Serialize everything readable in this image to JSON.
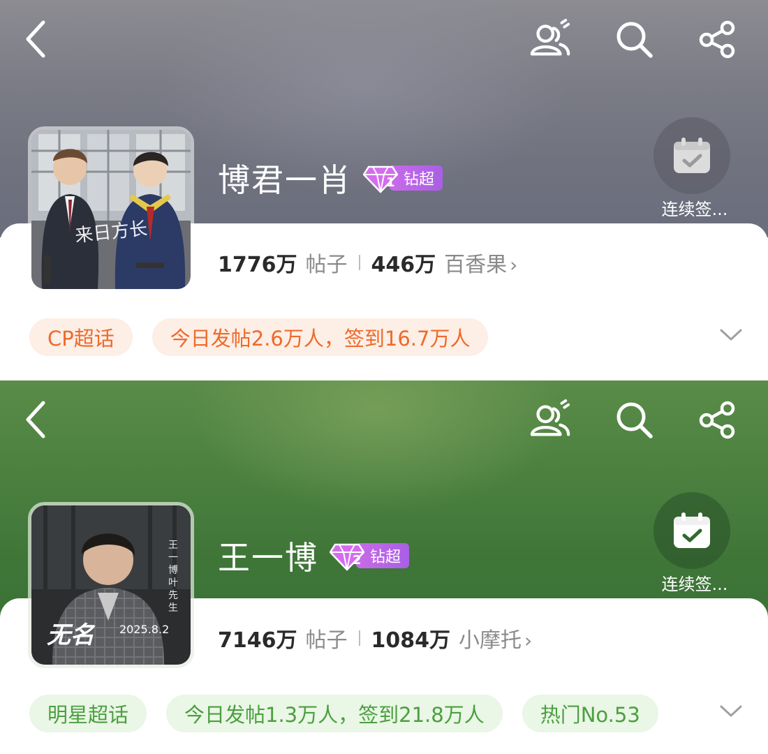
{
  "panels": [
    {
      "title": "博君一肖",
      "badge": {
        "level": "1",
        "label": "钻超"
      },
      "avatar_caption": "来日方长",
      "checkin_label": "连续签...",
      "stats": {
        "posts": "1776万",
        "posts_label": "帖子",
        "fans": "446万",
        "fans_label": "百香果"
      },
      "tags": [
        "CP超话",
        "今日发帖2.6万人，签到16.7万人"
      ],
      "accent_color": "#ee6a2a",
      "header_color": "#7b7c86"
    },
    {
      "title": "王一博",
      "badge": {
        "level": "2",
        "label": "钻超"
      },
      "avatar_caption": "2025.8.2",
      "avatar_title": "无名",
      "avatar_side_text": "王一博 叶先生",
      "checkin_label": "连续签...",
      "stats": {
        "posts": "7146万",
        "posts_label": "帖子",
        "fans": "1084万",
        "fans_label": "小摩托"
      },
      "tags": [
        "明星超话",
        "今日发帖1.3万人，签到21.8万人",
        "热门No.53"
      ],
      "accent_color": "#4aa03e",
      "header_color": "#4b8040"
    }
  ],
  "icons": {
    "back": "chevron-left-icon",
    "people": "people-icon",
    "search": "search-icon",
    "share": "share-icon",
    "checkin": "calendar-check-icon",
    "expand": "chevron-down-icon"
  }
}
